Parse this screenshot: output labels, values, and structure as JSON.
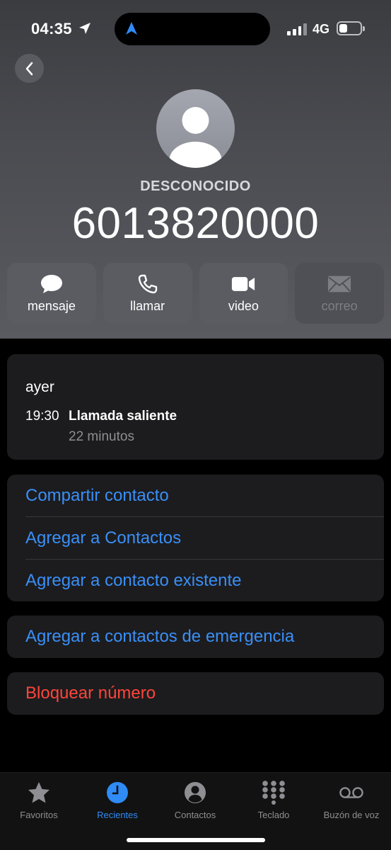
{
  "status_bar": {
    "time": "04:35",
    "network": "4G",
    "battery_level": 0.4
  },
  "contact": {
    "label": "DESCONOCIDO",
    "number": "6013820000"
  },
  "actions": [
    {
      "label": "mensaje",
      "icon": "message-bubble-icon",
      "enabled": true
    },
    {
      "label": "llamar",
      "icon": "phone-icon",
      "enabled": true
    },
    {
      "label": "video",
      "icon": "video-camera-icon",
      "enabled": true
    },
    {
      "label": "correo",
      "icon": "mail-icon",
      "enabled": false
    }
  ],
  "recent_call": {
    "day": "ayer",
    "time": "19:30",
    "type": "Llamada saliente",
    "duration": "22 minutos"
  },
  "options": [
    {
      "label": "Compartir contacto"
    },
    {
      "label": "Agregar a Contactos"
    },
    {
      "label": "Agregar a contacto existente"
    }
  ],
  "emergency_option": {
    "label": "Agregar a contactos de emergencia"
  },
  "block_option": {
    "label": "Bloquear número"
  },
  "tabs": [
    {
      "label": "Favoritos",
      "icon": "star-icon",
      "active": false
    },
    {
      "label": "Recientes",
      "icon": "clock-icon",
      "active": true
    },
    {
      "label": "Contactos",
      "icon": "person-circle-icon",
      "active": false
    },
    {
      "label": "Teclado",
      "icon": "keypad-icon",
      "active": false
    },
    {
      "label": "Buzón de voz",
      "icon": "voicemail-icon",
      "active": false
    }
  ],
  "colors": {
    "accent": "#3a8ff7",
    "destructive": "#ff453a",
    "card_bg": "#1c1c1e",
    "tab_active": "#2f8bf5",
    "tab_inactive": "#8e8e93"
  }
}
